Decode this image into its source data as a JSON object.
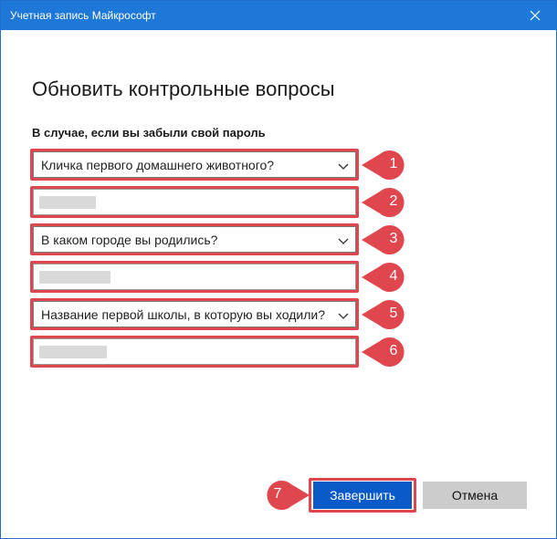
{
  "window": {
    "title": "Учетная запись Майкрософт"
  },
  "page": {
    "heading": "Обновить контрольные вопросы",
    "subheading": "В случае, если вы забыли свой пароль"
  },
  "questions": [
    {
      "question": "Кличка первого домашнего животного?",
      "answer": ""
    },
    {
      "question": "В каком городе вы родились?",
      "answer": ""
    },
    {
      "question": "Название первой школы, в которую вы ходили?",
      "answer": ""
    }
  ],
  "markers": [
    "1",
    "2",
    "3",
    "4",
    "5",
    "6",
    "7"
  ],
  "buttons": {
    "finish": "Завершить",
    "cancel": "Отмена"
  },
  "colors": {
    "titlebar": "#1e78d7",
    "primary": "#0a5ac8",
    "annotation": "#e0464d"
  }
}
